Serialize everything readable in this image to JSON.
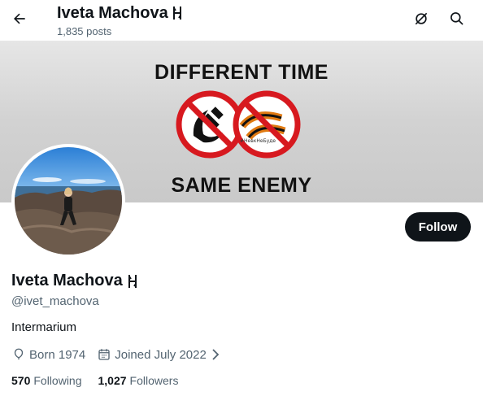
{
  "header": {
    "title": "Iveta Machova",
    "post_count": "1,835 posts",
    "icons": {
      "back": "arrow-left-icon",
      "grok": "grok-icon",
      "search": "search-icon",
      "badge": "wolfsangel-emoji"
    }
  },
  "banner": {
    "line1": "DIFFERENT TIME",
    "line2": "SAME ENEMY",
    "symbols": [
      "hammer-and-sickle-crossed",
      "st-george-ribbon-crossed"
    ],
    "ribbon_text": "#НевкНеБуде"
  },
  "profile": {
    "name": "Iveta Machova",
    "handle": "@ivet_machova",
    "bio": "Intermarium",
    "born": "Born 1974",
    "joined": "Joined July 2022",
    "follow_label": "Follow",
    "following_count": "570",
    "following_label": "Following",
    "followers_count": "1,027",
    "followers_label": "Followers"
  },
  "colors": {
    "text": "#0f1419",
    "muted": "#536471",
    "button": "#0f1419",
    "ban_red": "#d7191f"
  }
}
